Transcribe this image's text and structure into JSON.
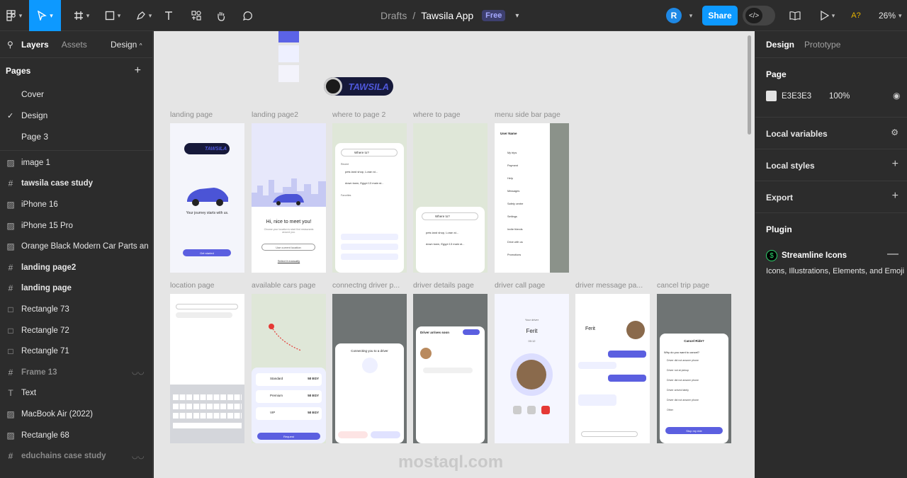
{
  "toolbar": {
    "file_title": "Tawsila App",
    "location": "Drafts",
    "plan_badge": "Free",
    "avatar_initial": "R",
    "share_label": "Share",
    "zoom": "26%",
    "ai_label": "A?"
  },
  "left_panel": {
    "tabs": {
      "layers": "Layers",
      "assets": "Assets",
      "page_switch": "Design"
    },
    "pages_title": "Pages",
    "pages": [
      {
        "label": "Cover",
        "selected": false
      },
      {
        "label": "Design",
        "selected": true
      },
      {
        "label": "Page 3",
        "selected": false
      }
    ],
    "layers": [
      {
        "label": "image 1",
        "icon": "image-icon",
        "style": "normal"
      },
      {
        "label": "tawsila case study",
        "icon": "frame-icon",
        "style": "bold"
      },
      {
        "label": "iPhone 16",
        "icon": "image-icon",
        "style": "normal"
      },
      {
        "label": "iPhone 15 Pro",
        "icon": "image-icon",
        "style": "normal"
      },
      {
        "label": "Orange Black Modern Car Parts an...",
        "icon": "image-icon",
        "style": "normal"
      },
      {
        "label": "landing page2",
        "icon": "frame-icon",
        "style": "bold"
      },
      {
        "label": "landing page",
        "icon": "frame-icon",
        "style": "bold"
      },
      {
        "label": "Rectangle 73",
        "icon": "rectangle-icon",
        "style": "normal"
      },
      {
        "label": "Rectangle 72",
        "icon": "rectangle-icon",
        "style": "normal"
      },
      {
        "label": "Rectangle 71",
        "icon": "rectangle-icon",
        "style": "normal"
      },
      {
        "label": "Frame 13",
        "icon": "frame-icon",
        "style": "dim"
      },
      {
        "label": "Text",
        "icon": "text-icon",
        "style": "normal"
      },
      {
        "label": "MacBook Air (2022)",
        "icon": "image-icon",
        "style": "normal"
      },
      {
        "label": "Rectangle 68",
        "icon": "image-icon",
        "style": "normal"
      },
      {
        "label": "educhains case study",
        "icon": "frame-icon",
        "style": "dim"
      }
    ]
  },
  "canvas": {
    "logo_text": "TAWSILA",
    "row1_labels": [
      "landing page",
      "landing page2",
      "where to page 2",
      "where to page",
      "menu side bar page"
    ],
    "row2_labels": [
      "location page",
      "available cars page",
      "connectng driver p...",
      "driver details page",
      "driver call page",
      "driver message pa...",
      "cancel trip page"
    ],
    "screens": {
      "landing_tagline": "Your journey starts with us.",
      "landing_cta": "Get started",
      "landing2_title": "Hi, nice to meet you!",
      "landing2_sub": "Choose your location to start find restaurants around you.",
      "landing2_btn": "Use current location",
      "landing2_link": "Select it manually",
      "where_to": "Where to?",
      "recent_label": "Recent",
      "recent_1": "pets land shop, Loran st...",
      "recent_2": "down town, Egypt 13 main st...",
      "favorites_label": "Favorites",
      "menu_user": "User Name",
      "menu_items": [
        "My trips",
        "Payment",
        "Help",
        "Messages",
        "Safety centre",
        "Settings",
        "Invite friends",
        "Drive with us",
        "Promotions"
      ],
      "connecting_title": "Connecting you to a driver",
      "driver_arrives": "Driver arrives soon",
      "driver_name": "Ferit",
      "call_label": "Your driver",
      "call_time": "00:12",
      "cancel_title": "Cancel Ride?",
      "cancel_question": "Why do you want to cancel?",
      "cancel_reasons": [
        "Driver did not answer phone",
        "Driver not at pickup",
        "Driver did not answer phone",
        "Driver arrived lately",
        "Driver did not answer phone",
        "Other"
      ],
      "cancel_btn": "Stop my ride",
      "request_btn": "Request",
      "cars": [
        {
          "name": "Standard",
          "price": "50 EGY"
        },
        {
          "name": "Premium",
          "price": "50 EGY"
        },
        {
          "name": "VIP",
          "price": "50 EGY"
        }
      ]
    },
    "watermark": "mostaql.com"
  },
  "right_panel": {
    "tabs": {
      "design": "Design",
      "prototype": "Prototype"
    },
    "page_section": {
      "title": "Page",
      "color_hex": "E3E3E3",
      "opacity": "100%",
      "color": "#e3e3e3"
    },
    "local_variables": "Local variables",
    "local_styles": "Local styles",
    "export": "Export",
    "plugin_title": "Plugin",
    "plugin_name": "Streamline Icons",
    "plugin_desc": "Icons, Illustrations, Elements, and Emoji"
  }
}
